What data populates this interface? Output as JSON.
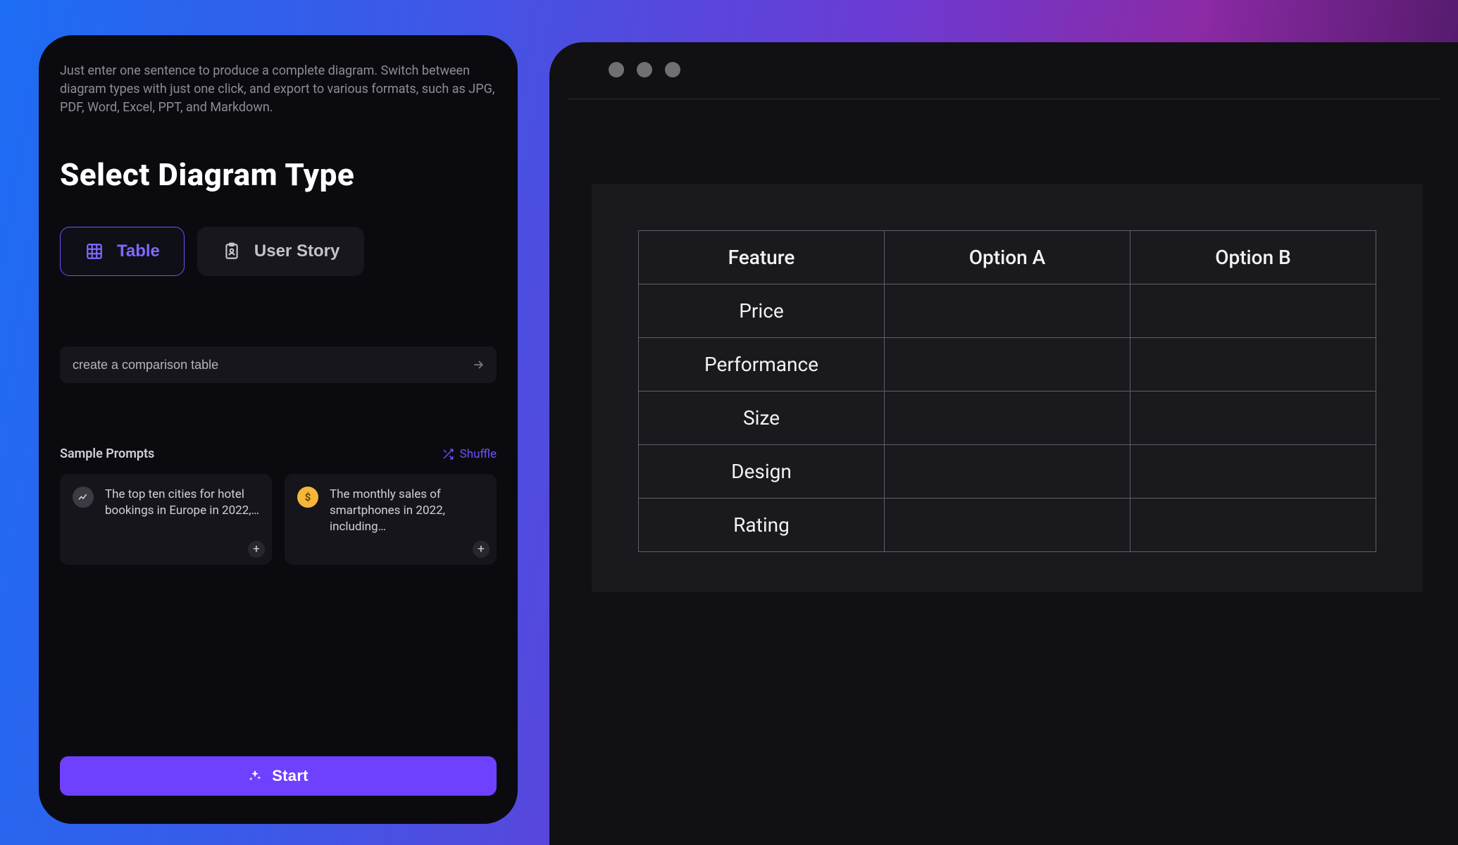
{
  "intro": "Just enter one sentence to produce a complete diagram. Switch between diagram types with just one click, and export to various formats, such as JPG, PDF, Word, Excel, PPT, and Markdown.",
  "heading": "Select Diagram Type",
  "types": {
    "table": {
      "label": "Table",
      "selected": true
    },
    "userstory": {
      "label": "User Story",
      "selected": false
    }
  },
  "prompt_value": "create a comparison table",
  "samples_label": "Sample Prompts",
  "shuffle_label": "Shuffle",
  "sample_cards": [
    {
      "icon": "chart",
      "text": "The top ten cities for hotel bookings in Europe in 2022,…"
    },
    {
      "icon": "coin",
      "text": "The monthly sales of smartphones in 2022, including…"
    }
  ],
  "start_label": "Start",
  "chart_data": {
    "type": "table",
    "title": "",
    "columns": [
      "Feature",
      "Option A",
      "Option B"
    ],
    "rows": [
      {
        "label": "Price",
        "values": [
          "",
          ""
        ]
      },
      {
        "label": "Performance",
        "values": [
          "",
          ""
        ]
      },
      {
        "label": "Size",
        "values": [
          "",
          ""
        ]
      },
      {
        "label": "Design",
        "values": [
          "",
          ""
        ]
      },
      {
        "label": "Rating",
        "values": [
          "",
          ""
        ]
      }
    ]
  }
}
